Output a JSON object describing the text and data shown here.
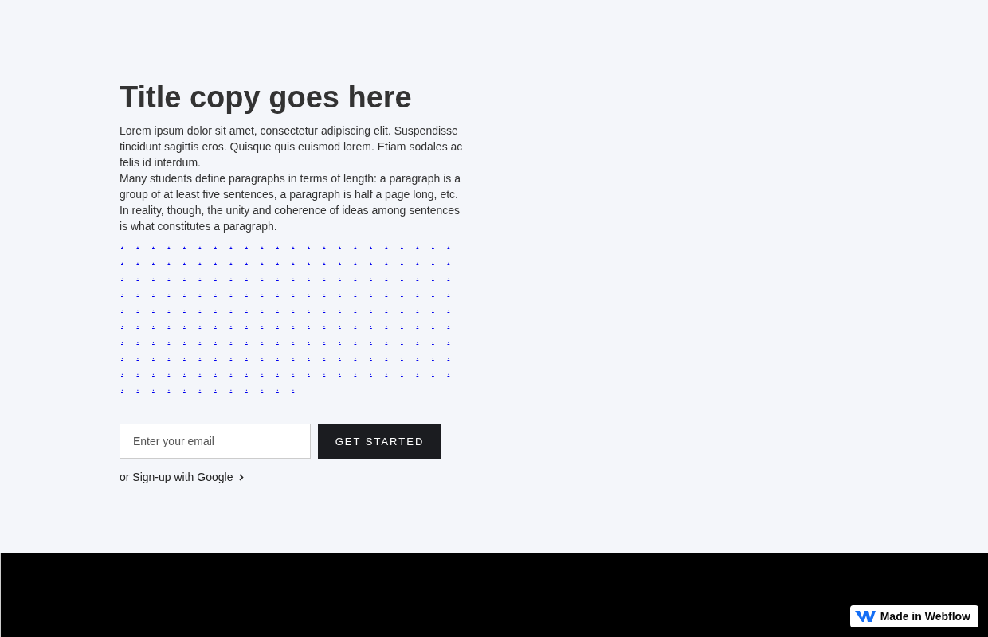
{
  "hero": {
    "title": "Title copy goes here",
    "paragraphs": [
      "Lorem ipsum dolor sit amet, consectetur adipiscing elit. Suspendisse tincidunt sagittis eros. Quisque quis euismod lorem. Etiam sodales ac felis id interdum.",
      "Many students define paragraphs in terms of length: a paragraph is a group of at least five sentences, a paragraph is half a page long, etc. In reality, though, the unity and coherence of ideas among sentences is what constitutes a paragraph."
    ],
    "dot_links": [
      ".",
      ".",
      ".",
      ".",
      ".",
      ".",
      ".",
      ".",
      ".",
      ".",
      ".",
      ".",
      ".",
      ".",
      ".",
      ".",
      ".",
      ".",
      ".",
      ".",
      ".",
      ".",
      ".",
      ".",
      ".",
      ".",
      ".",
      ".",
      ".",
      ".",
      ".",
      ".",
      ".",
      ".",
      ".",
      ".",
      ".",
      ".",
      ".",
      ".",
      ".",
      ".",
      ".",
      ".",
      ".",
      ".",
      ".",
      ".",
      ".",
      ".",
      ".",
      ".",
      ".",
      ".",
      ".",
      ".",
      ".",
      ".",
      ".",
      ".",
      ".",
      ".",
      ".",
      ".",
      ".",
      ".",
      ".",
      ".",
      ".",
      ".",
      ".",
      ".",
      ".",
      ".",
      ".",
      ".",
      ".",
      ".",
      ".",
      ".",
      ".",
      ".",
      ".",
      ".",
      ".",
      ".",
      ".",
      ".",
      ".",
      ".",
      ".",
      ".",
      ".",
      ".",
      ".",
      ".",
      ".",
      ".",
      ".",
      ".",
      ".",
      ".",
      ".",
      ".",
      ".",
      ".",
      ".",
      ".",
      ".",
      ".",
      ".",
      ".",
      ".",
      ".",
      ".",
      ".",
      ".",
      ".",
      ".",
      ".",
      ".",
      ".",
      ".",
      ".",
      ".",
      ".",
      ".",
      ".",
      ".",
      ".",
      ".",
      ".",
      ".",
      ".",
      ".",
      ".",
      ".",
      ".",
      ".",
      ".",
      ".",
      ".",
      ".",
      ".",
      ".",
      ".",
      ".",
      ".",
      ".",
      ".",
      ".",
      ".",
      ".",
      ".",
      ".",
      ".",
      ".",
      ".",
      ".",
      ".",
      ".",
      ".",
      ".",
      ".",
      ".",
      ".",
      ".",
      ".",
      ".",
      ".",
      ".",
      ".",
      ".",
      ".",
      ".",
      ".",
      ".",
      ".",
      ".",
      ".",
      ".",
      ".",
      ".",
      ".",
      ".",
      ".",
      ".",
      ".",
      ".",
      ".",
      ".",
      ".",
      ".",
      ".",
      ".",
      ".",
      ".",
      ".",
      ".",
      ".",
      ".",
      ".",
      ".",
      ".",
      ".",
      ".",
      ".",
      ".",
      ".",
      "."
    ],
    "email": {
      "placeholder": "Enter your email"
    },
    "submit": "GET STARTED",
    "google_link": "or Sign-up with Google"
  },
  "badge": {
    "label": "Made in Webflow"
  }
}
